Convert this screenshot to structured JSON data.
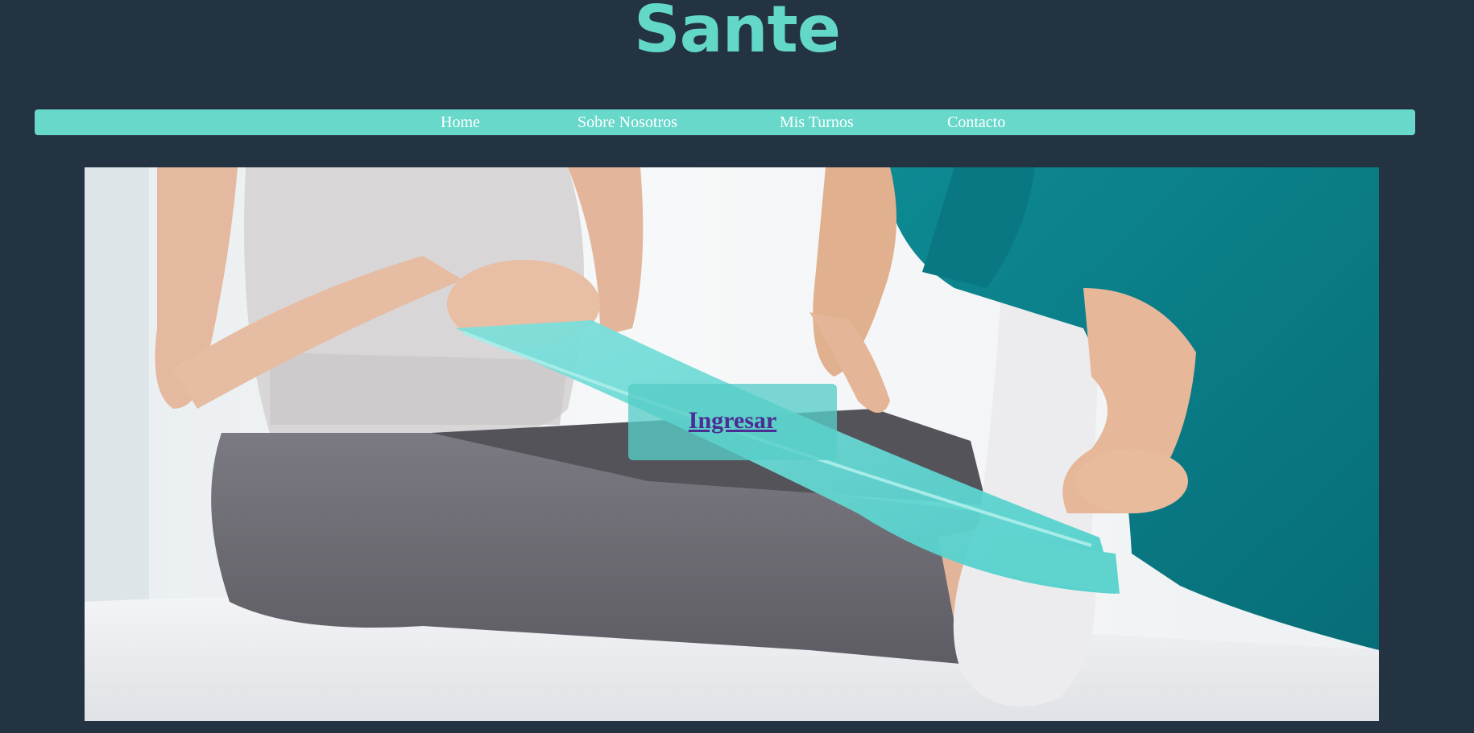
{
  "header": {
    "title": "Sante"
  },
  "nav": {
    "items": [
      {
        "label": "Home"
      },
      {
        "label": "Sobre Nosotros"
      },
      {
        "label": "Mis Turnos"
      },
      {
        "label": "Contacto"
      }
    ]
  },
  "hero": {
    "image": "physiotherapy-resistance-band-photo"
  },
  "login": {
    "label": "Ingresar"
  },
  "colors": {
    "page_background": "#233341",
    "accent": "#63d8c9",
    "navbar": "#68d8cb",
    "link": "#4b2d93"
  }
}
